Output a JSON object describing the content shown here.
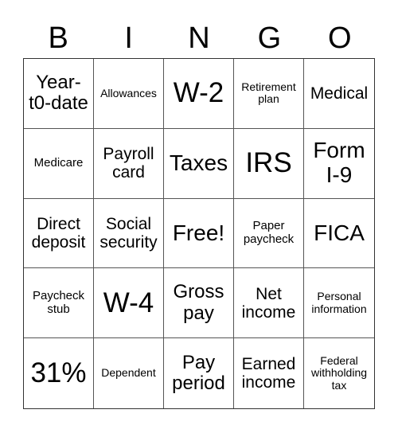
{
  "header": {
    "letters": [
      "B",
      "I",
      "N",
      "G",
      "O"
    ]
  },
  "cells": [
    {
      "text": "Year-\nt0-date",
      "size": "s-m"
    },
    {
      "text": "Allowances",
      "size": "s-xxs"
    },
    {
      "text": "W-2",
      "size": "s-xl"
    },
    {
      "text": "Retirement plan",
      "size": "s-xxs"
    },
    {
      "text": "Medical",
      "size": "s-ms"
    },
    {
      "text": "Medicare",
      "size": "s-xs"
    },
    {
      "text": "Payroll card",
      "size": "s-ms"
    },
    {
      "text": "Taxes",
      "size": "s-l"
    },
    {
      "text": "IRS",
      "size": "s-xl"
    },
    {
      "text": "Form I-9",
      "size": "s-l"
    },
    {
      "text": "Direct deposit",
      "size": "s-ms"
    },
    {
      "text": "Social security",
      "size": "s-ms"
    },
    {
      "text": "Free!",
      "size": "s-l"
    },
    {
      "text": "Paper paycheck",
      "size": "s-xs"
    },
    {
      "text": "FICA",
      "size": "s-l"
    },
    {
      "text": "Paycheck stub",
      "size": "s-xs"
    },
    {
      "text": "W-4",
      "size": "s-xl"
    },
    {
      "text": "Gross pay",
      "size": "s-m"
    },
    {
      "text": "Net income",
      "size": "s-ms"
    },
    {
      "text": "Personal information",
      "size": "s-xxs"
    },
    {
      "text": "31%",
      "size": "s-xl"
    },
    {
      "text": "Dependent",
      "size": "s-xxs"
    },
    {
      "text": "Pay period",
      "size": "s-m"
    },
    {
      "text": "Earned income",
      "size": "s-ms"
    },
    {
      "text": "Federal withholding tax",
      "size": "s-xxs"
    }
  ]
}
